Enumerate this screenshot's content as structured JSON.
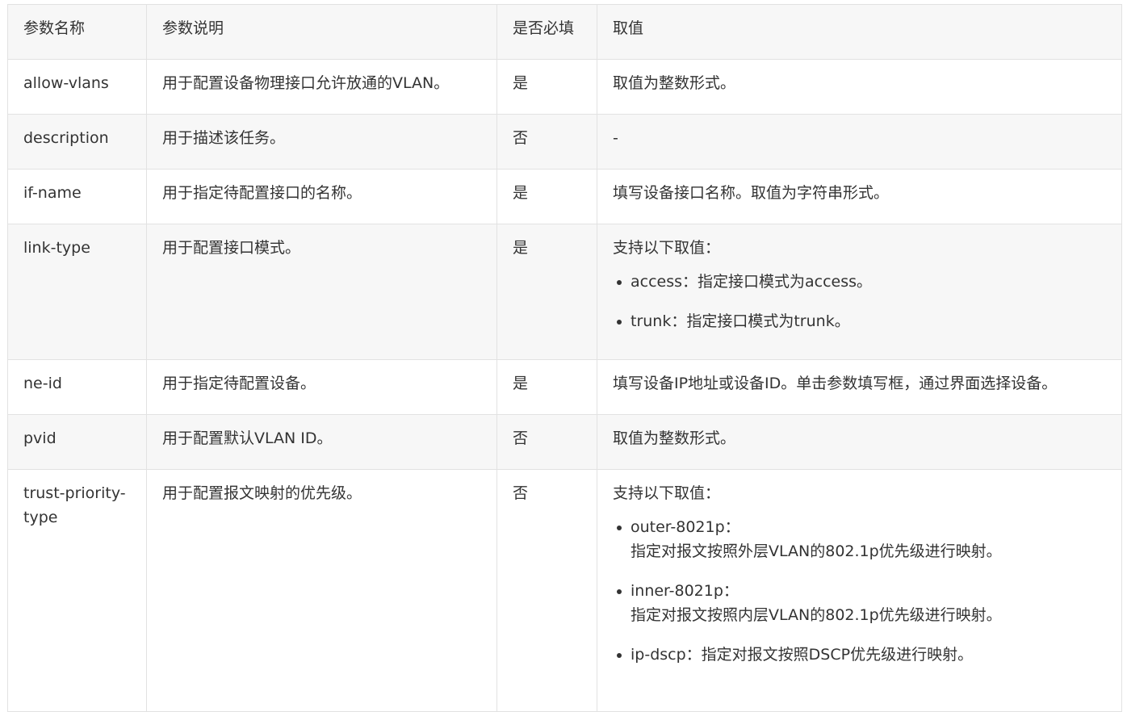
{
  "table": {
    "headers": [
      "参数名称",
      "参数说明",
      "是否必填",
      "取值"
    ],
    "rows": [
      {
        "name": "allow-vlans",
        "desc": "用于配置设备物理接口允许放通的VLAN。",
        "required": "是",
        "value": "取值为整数形式。"
      },
      {
        "name": "description",
        "desc": "用于描述该任务。",
        "required": "否",
        "value": "-"
      },
      {
        "name": "if-name",
        "desc": "用于指定待配置接口的名称。",
        "required": "是",
        "value": "填写设备接口名称。取值为字符串形式。"
      },
      {
        "name": "link-type",
        "desc": "用于配置接口模式。",
        "required": "是",
        "value": "支持以下取值：",
        "options": [
          {
            "text": "access：指定接口模式为access。"
          },
          {
            "text": "trunk：指定接口模式为trunk。"
          }
        ]
      },
      {
        "name": "ne-id",
        "desc": "用于指定待配置设备。",
        "required": "是",
        "value": "填写设备IP地址或设备ID。单击参数填写框，通过界面选择设备。"
      },
      {
        "name": "pvid",
        "desc": "用于配置默认VLAN ID。",
        "required": "否",
        "value": "取值为整数形式。"
      },
      {
        "name": "trust-priority-type",
        "desc": "用于配置报文映射的优先级。",
        "required": "否",
        "value": "支持以下取值：",
        "options": [
          {
            "text": "outer-8021p：",
            "detail": "指定对报文按照外层VLAN的802.1p优先级进行映射。"
          },
          {
            "text": "inner-8021p：",
            "detail": "指定对报文按照内层VLAN的802.1p优先级进行映射。"
          },
          {
            "text": "ip-dscp：指定对报文按照DSCP优先级进行映射。"
          }
        ]
      }
    ]
  }
}
